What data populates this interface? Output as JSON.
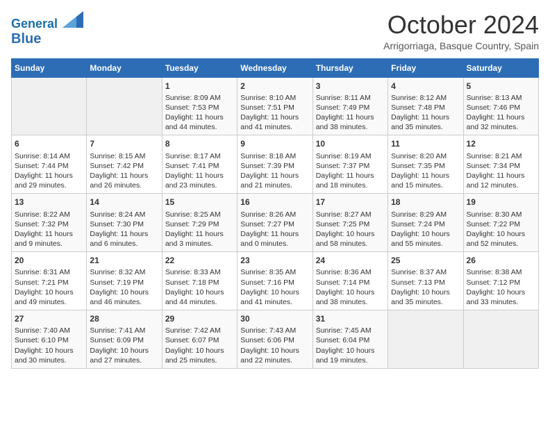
{
  "header": {
    "logo_line1": "General",
    "logo_line2": "Blue",
    "month_year": "October 2024",
    "location": "Arrigorriaga, Basque Country, Spain"
  },
  "days_of_week": [
    "Sunday",
    "Monday",
    "Tuesday",
    "Wednesday",
    "Thursday",
    "Friday",
    "Saturday"
  ],
  "weeks": [
    [
      {
        "day": "",
        "info": ""
      },
      {
        "day": "",
        "info": ""
      },
      {
        "day": "1",
        "info": "Sunrise: 8:09 AM\nSunset: 7:53 PM\nDaylight: 11 hours and 44 minutes."
      },
      {
        "day": "2",
        "info": "Sunrise: 8:10 AM\nSunset: 7:51 PM\nDaylight: 11 hours and 41 minutes."
      },
      {
        "day": "3",
        "info": "Sunrise: 8:11 AM\nSunset: 7:49 PM\nDaylight: 11 hours and 38 minutes."
      },
      {
        "day": "4",
        "info": "Sunrise: 8:12 AM\nSunset: 7:48 PM\nDaylight: 11 hours and 35 minutes."
      },
      {
        "day": "5",
        "info": "Sunrise: 8:13 AM\nSunset: 7:46 PM\nDaylight: 11 hours and 32 minutes."
      }
    ],
    [
      {
        "day": "6",
        "info": "Sunrise: 8:14 AM\nSunset: 7:44 PM\nDaylight: 11 hours and 29 minutes."
      },
      {
        "day": "7",
        "info": "Sunrise: 8:15 AM\nSunset: 7:42 PM\nDaylight: 11 hours and 26 minutes."
      },
      {
        "day": "8",
        "info": "Sunrise: 8:17 AM\nSunset: 7:41 PM\nDaylight: 11 hours and 23 minutes."
      },
      {
        "day": "9",
        "info": "Sunrise: 8:18 AM\nSunset: 7:39 PM\nDaylight: 11 hours and 21 minutes."
      },
      {
        "day": "10",
        "info": "Sunrise: 8:19 AM\nSunset: 7:37 PM\nDaylight: 11 hours and 18 minutes."
      },
      {
        "day": "11",
        "info": "Sunrise: 8:20 AM\nSunset: 7:35 PM\nDaylight: 11 hours and 15 minutes."
      },
      {
        "day": "12",
        "info": "Sunrise: 8:21 AM\nSunset: 7:34 PM\nDaylight: 11 hours and 12 minutes."
      }
    ],
    [
      {
        "day": "13",
        "info": "Sunrise: 8:22 AM\nSunset: 7:32 PM\nDaylight: 11 hours and 9 minutes."
      },
      {
        "day": "14",
        "info": "Sunrise: 8:24 AM\nSunset: 7:30 PM\nDaylight: 11 hours and 6 minutes."
      },
      {
        "day": "15",
        "info": "Sunrise: 8:25 AM\nSunset: 7:29 PM\nDaylight: 11 hours and 3 minutes."
      },
      {
        "day": "16",
        "info": "Sunrise: 8:26 AM\nSunset: 7:27 PM\nDaylight: 11 hours and 0 minutes."
      },
      {
        "day": "17",
        "info": "Sunrise: 8:27 AM\nSunset: 7:25 PM\nDaylight: 10 hours and 58 minutes."
      },
      {
        "day": "18",
        "info": "Sunrise: 8:29 AM\nSunset: 7:24 PM\nDaylight: 10 hours and 55 minutes."
      },
      {
        "day": "19",
        "info": "Sunrise: 8:30 AM\nSunset: 7:22 PM\nDaylight: 10 hours and 52 minutes."
      }
    ],
    [
      {
        "day": "20",
        "info": "Sunrise: 8:31 AM\nSunset: 7:21 PM\nDaylight: 10 hours and 49 minutes."
      },
      {
        "day": "21",
        "info": "Sunrise: 8:32 AM\nSunset: 7:19 PM\nDaylight: 10 hours and 46 minutes."
      },
      {
        "day": "22",
        "info": "Sunrise: 8:33 AM\nSunset: 7:18 PM\nDaylight: 10 hours and 44 minutes."
      },
      {
        "day": "23",
        "info": "Sunrise: 8:35 AM\nSunset: 7:16 PM\nDaylight: 10 hours and 41 minutes."
      },
      {
        "day": "24",
        "info": "Sunrise: 8:36 AM\nSunset: 7:14 PM\nDaylight: 10 hours and 38 minutes."
      },
      {
        "day": "25",
        "info": "Sunrise: 8:37 AM\nSunset: 7:13 PM\nDaylight: 10 hours and 35 minutes."
      },
      {
        "day": "26",
        "info": "Sunrise: 8:38 AM\nSunset: 7:12 PM\nDaylight: 10 hours and 33 minutes."
      }
    ],
    [
      {
        "day": "27",
        "info": "Sunrise: 7:40 AM\nSunset: 6:10 PM\nDaylight: 10 hours and 30 minutes."
      },
      {
        "day": "28",
        "info": "Sunrise: 7:41 AM\nSunset: 6:09 PM\nDaylight: 10 hours and 27 minutes."
      },
      {
        "day": "29",
        "info": "Sunrise: 7:42 AM\nSunset: 6:07 PM\nDaylight: 10 hours and 25 minutes."
      },
      {
        "day": "30",
        "info": "Sunrise: 7:43 AM\nSunset: 6:06 PM\nDaylight: 10 hours and 22 minutes."
      },
      {
        "day": "31",
        "info": "Sunrise: 7:45 AM\nSunset: 6:04 PM\nDaylight: 10 hours and 19 minutes."
      },
      {
        "day": "",
        "info": ""
      },
      {
        "day": "",
        "info": ""
      }
    ]
  ]
}
